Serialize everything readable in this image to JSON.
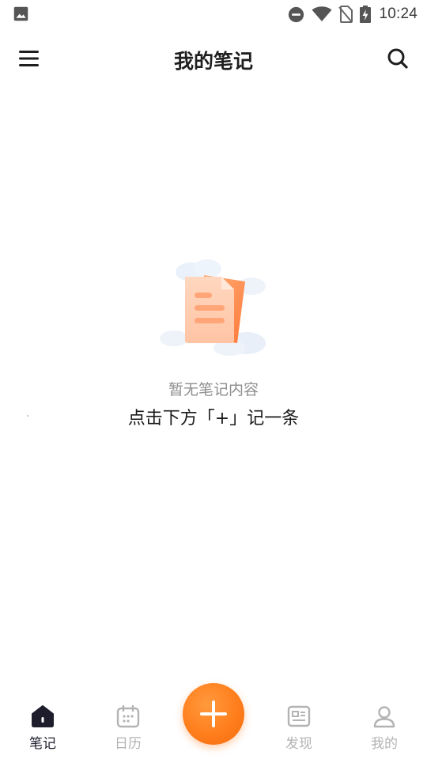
{
  "status_bar": {
    "time": "10:24",
    "icons": [
      "gallery-icon",
      "do-not-disturb-icon",
      "wifi-icon",
      "no-sim-icon",
      "battery-charging-icon"
    ]
  },
  "header": {
    "title": "我的笔记",
    "left_icon": "menu-icon",
    "right_icon": "search-icon"
  },
  "empty_state": {
    "illustration": "empty-notes-illustration",
    "title": "暂无笔记内容",
    "hint": "点击下方「+」记一条"
  },
  "tab_bar": {
    "tabs": [
      {
        "label": "笔记",
        "icon": "home-icon",
        "active": true
      },
      {
        "label": "日历",
        "icon": "calendar-icon",
        "active": false
      },
      {
        "label": "发现",
        "icon": "news-icon",
        "active": false
      },
      {
        "label": "我的",
        "icon": "user-icon",
        "active": false
      }
    ],
    "add_icon": "plus-icon"
  },
  "colors": {
    "accent": "#ff7e1c",
    "active_tab": "#1d1d2c",
    "inactive_tab": "#b3b3b3",
    "title_text": "#1e1e1e",
    "muted_text": "#8e8e8e"
  }
}
